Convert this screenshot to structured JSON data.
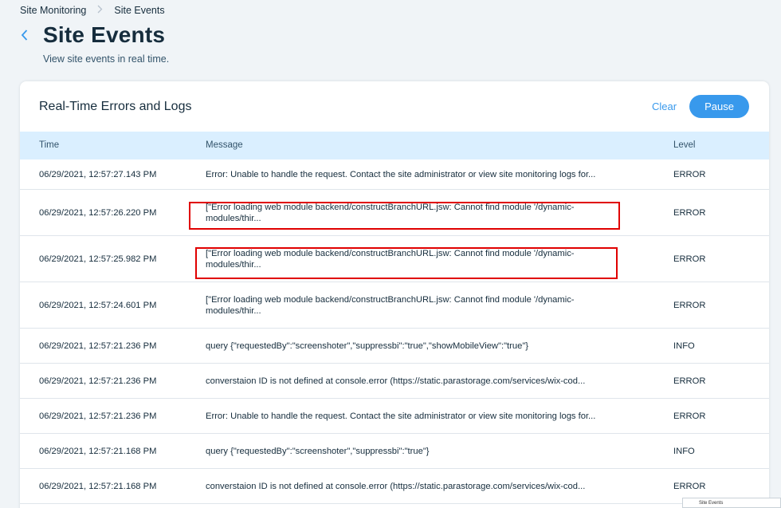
{
  "breadcrumb": {
    "parent": "Site Monitoring",
    "current": "Site Events"
  },
  "page": {
    "title": "Site Events",
    "subtitle": "View site events in real time."
  },
  "card": {
    "title": "Real-Time Errors and Logs",
    "clear_label": "Clear",
    "pause_label": "Pause"
  },
  "table": {
    "headers": {
      "time": "Time",
      "message": "Message",
      "level": "Level"
    },
    "rows": [
      {
        "time": "06/29/2021, 12:57:27.143 PM",
        "message": "Error: Unable to handle the request. Contact the site administrator or view site monitoring logs for...",
        "level": "ERROR"
      },
      {
        "time": "06/29/2021, 12:57:26.220 PM",
        "message": "[\"Error loading web module backend/constructBranchURL.jsw: Cannot find module '/dynamic-modules/thir...",
        "level": "ERROR"
      },
      {
        "time": "06/29/2021, 12:57:25.982 PM",
        "message": "[\"Error loading web module backend/constructBranchURL.jsw: Cannot find module '/dynamic-modules/thir...",
        "level": "ERROR"
      },
      {
        "time": "06/29/2021, 12:57:24.601 PM",
        "message": "[\"Error loading web module backend/constructBranchURL.jsw: Cannot find module '/dynamic-modules/thir...",
        "level": "ERROR"
      },
      {
        "time": "06/29/2021, 12:57:21.236 PM",
        "message": "query {\"requestedBy\":\"screenshoter\",\"suppressbi\":\"true\",\"showMobileView\":\"true\"}",
        "level": "INFO"
      },
      {
        "time": "06/29/2021, 12:57:21.236 PM",
        "message": "converstaion ID is not defined at console.error (https://static.parastorage.com/services/wix-cod...",
        "level": "ERROR"
      },
      {
        "time": "06/29/2021, 12:57:21.236 PM",
        "message": "Error: Unable to handle the request. Contact the site administrator or view site monitoring logs for...",
        "level": "ERROR"
      },
      {
        "time": "06/29/2021, 12:57:21.168 PM",
        "message": "query {\"requestedBy\":\"screenshoter\",\"suppressbi\":\"true\"}",
        "level": "INFO"
      },
      {
        "time": "06/29/2021, 12:57:21.168 PM",
        "message": "converstaion ID is not defined at console.error (https://static.parastorage.com/services/wix-cod...",
        "level": "ERROR"
      }
    ]
  },
  "thumbnail": {
    "label": "Site Events"
  },
  "colors": {
    "accent": "#3899ec",
    "header_bg": "#daefff",
    "highlight": "#e00000"
  }
}
